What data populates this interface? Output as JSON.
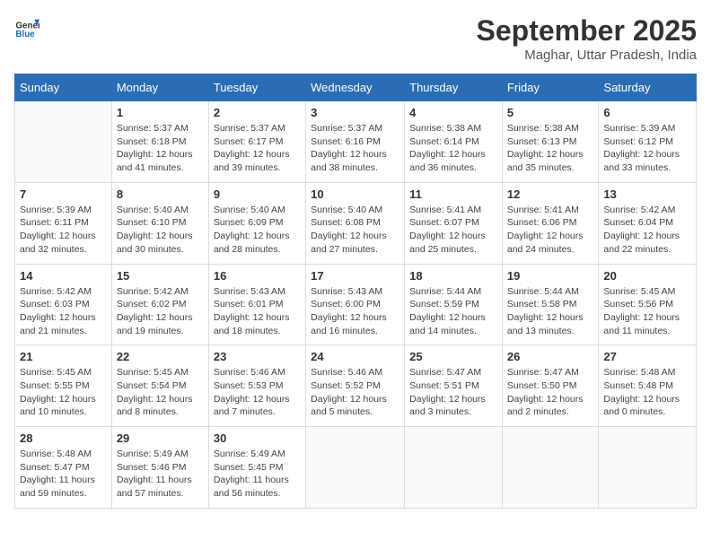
{
  "header": {
    "logo_general": "General",
    "logo_blue": "Blue",
    "month_title": "September 2025",
    "subtitle": "Maghar, Uttar Pradesh, India"
  },
  "weekdays": [
    "Sunday",
    "Monday",
    "Tuesday",
    "Wednesday",
    "Thursday",
    "Friday",
    "Saturday"
  ],
  "weeks": [
    [
      {
        "day": "",
        "sunrise": "",
        "sunset": "",
        "daylight": "",
        "empty": true
      },
      {
        "day": "1",
        "sunrise": "Sunrise: 5:37 AM",
        "sunset": "Sunset: 6:18 PM",
        "daylight": "Daylight: 12 hours and 41 minutes."
      },
      {
        "day": "2",
        "sunrise": "Sunrise: 5:37 AM",
        "sunset": "Sunset: 6:17 PM",
        "daylight": "Daylight: 12 hours and 39 minutes."
      },
      {
        "day": "3",
        "sunrise": "Sunrise: 5:37 AM",
        "sunset": "Sunset: 6:16 PM",
        "daylight": "Daylight: 12 hours and 38 minutes."
      },
      {
        "day": "4",
        "sunrise": "Sunrise: 5:38 AM",
        "sunset": "Sunset: 6:14 PM",
        "daylight": "Daylight: 12 hours and 36 minutes."
      },
      {
        "day": "5",
        "sunrise": "Sunrise: 5:38 AM",
        "sunset": "Sunset: 6:13 PM",
        "daylight": "Daylight: 12 hours and 35 minutes."
      },
      {
        "day": "6",
        "sunrise": "Sunrise: 5:39 AM",
        "sunset": "Sunset: 6:12 PM",
        "daylight": "Daylight: 12 hours and 33 minutes."
      }
    ],
    [
      {
        "day": "7",
        "sunrise": "Sunrise: 5:39 AM",
        "sunset": "Sunset: 6:11 PM",
        "daylight": "Daylight: 12 hours and 32 minutes."
      },
      {
        "day": "8",
        "sunrise": "Sunrise: 5:40 AM",
        "sunset": "Sunset: 6:10 PM",
        "daylight": "Daylight: 12 hours and 30 minutes."
      },
      {
        "day": "9",
        "sunrise": "Sunrise: 5:40 AM",
        "sunset": "Sunset: 6:09 PM",
        "daylight": "Daylight: 12 hours and 28 minutes."
      },
      {
        "day": "10",
        "sunrise": "Sunrise: 5:40 AM",
        "sunset": "Sunset: 6:08 PM",
        "daylight": "Daylight: 12 hours and 27 minutes."
      },
      {
        "day": "11",
        "sunrise": "Sunrise: 5:41 AM",
        "sunset": "Sunset: 6:07 PM",
        "daylight": "Daylight: 12 hours and 25 minutes."
      },
      {
        "day": "12",
        "sunrise": "Sunrise: 5:41 AM",
        "sunset": "Sunset: 6:06 PM",
        "daylight": "Daylight: 12 hours and 24 minutes."
      },
      {
        "day": "13",
        "sunrise": "Sunrise: 5:42 AM",
        "sunset": "Sunset: 6:04 PM",
        "daylight": "Daylight: 12 hours and 22 minutes."
      }
    ],
    [
      {
        "day": "14",
        "sunrise": "Sunrise: 5:42 AM",
        "sunset": "Sunset: 6:03 PM",
        "daylight": "Daylight: 12 hours and 21 minutes."
      },
      {
        "day": "15",
        "sunrise": "Sunrise: 5:42 AM",
        "sunset": "Sunset: 6:02 PM",
        "daylight": "Daylight: 12 hours and 19 minutes."
      },
      {
        "day": "16",
        "sunrise": "Sunrise: 5:43 AM",
        "sunset": "Sunset: 6:01 PM",
        "daylight": "Daylight: 12 hours and 18 minutes."
      },
      {
        "day": "17",
        "sunrise": "Sunrise: 5:43 AM",
        "sunset": "Sunset: 6:00 PM",
        "daylight": "Daylight: 12 hours and 16 minutes."
      },
      {
        "day": "18",
        "sunrise": "Sunrise: 5:44 AM",
        "sunset": "Sunset: 5:59 PM",
        "daylight": "Daylight: 12 hours and 14 minutes."
      },
      {
        "day": "19",
        "sunrise": "Sunrise: 5:44 AM",
        "sunset": "Sunset: 5:58 PM",
        "daylight": "Daylight: 12 hours and 13 minutes."
      },
      {
        "day": "20",
        "sunrise": "Sunrise: 5:45 AM",
        "sunset": "Sunset: 5:56 PM",
        "daylight": "Daylight: 12 hours and 11 minutes."
      }
    ],
    [
      {
        "day": "21",
        "sunrise": "Sunrise: 5:45 AM",
        "sunset": "Sunset: 5:55 PM",
        "daylight": "Daylight: 12 hours and 10 minutes."
      },
      {
        "day": "22",
        "sunrise": "Sunrise: 5:45 AM",
        "sunset": "Sunset: 5:54 PM",
        "daylight": "Daylight: 12 hours and 8 minutes."
      },
      {
        "day": "23",
        "sunrise": "Sunrise: 5:46 AM",
        "sunset": "Sunset: 5:53 PM",
        "daylight": "Daylight: 12 hours and 7 minutes."
      },
      {
        "day": "24",
        "sunrise": "Sunrise: 5:46 AM",
        "sunset": "Sunset: 5:52 PM",
        "daylight": "Daylight: 12 hours and 5 minutes."
      },
      {
        "day": "25",
        "sunrise": "Sunrise: 5:47 AM",
        "sunset": "Sunset: 5:51 PM",
        "daylight": "Daylight: 12 hours and 3 minutes."
      },
      {
        "day": "26",
        "sunrise": "Sunrise: 5:47 AM",
        "sunset": "Sunset: 5:50 PM",
        "daylight": "Daylight: 12 hours and 2 minutes."
      },
      {
        "day": "27",
        "sunrise": "Sunrise: 5:48 AM",
        "sunset": "Sunset: 5:48 PM",
        "daylight": "Daylight: 12 hours and 0 minutes."
      }
    ],
    [
      {
        "day": "28",
        "sunrise": "Sunrise: 5:48 AM",
        "sunset": "Sunset: 5:47 PM",
        "daylight": "Daylight: 11 hours and 59 minutes."
      },
      {
        "day": "29",
        "sunrise": "Sunrise: 5:49 AM",
        "sunset": "Sunset: 5:46 PM",
        "daylight": "Daylight: 11 hours and 57 minutes."
      },
      {
        "day": "30",
        "sunrise": "Sunrise: 5:49 AM",
        "sunset": "Sunset: 5:45 PM",
        "daylight": "Daylight: 11 hours and 56 minutes."
      },
      {
        "day": "",
        "sunrise": "",
        "sunset": "",
        "daylight": "",
        "empty": true
      },
      {
        "day": "",
        "sunrise": "",
        "sunset": "",
        "daylight": "",
        "empty": true
      },
      {
        "day": "",
        "sunrise": "",
        "sunset": "",
        "daylight": "",
        "empty": true
      },
      {
        "day": "",
        "sunrise": "",
        "sunset": "",
        "daylight": "",
        "empty": true
      }
    ]
  ]
}
